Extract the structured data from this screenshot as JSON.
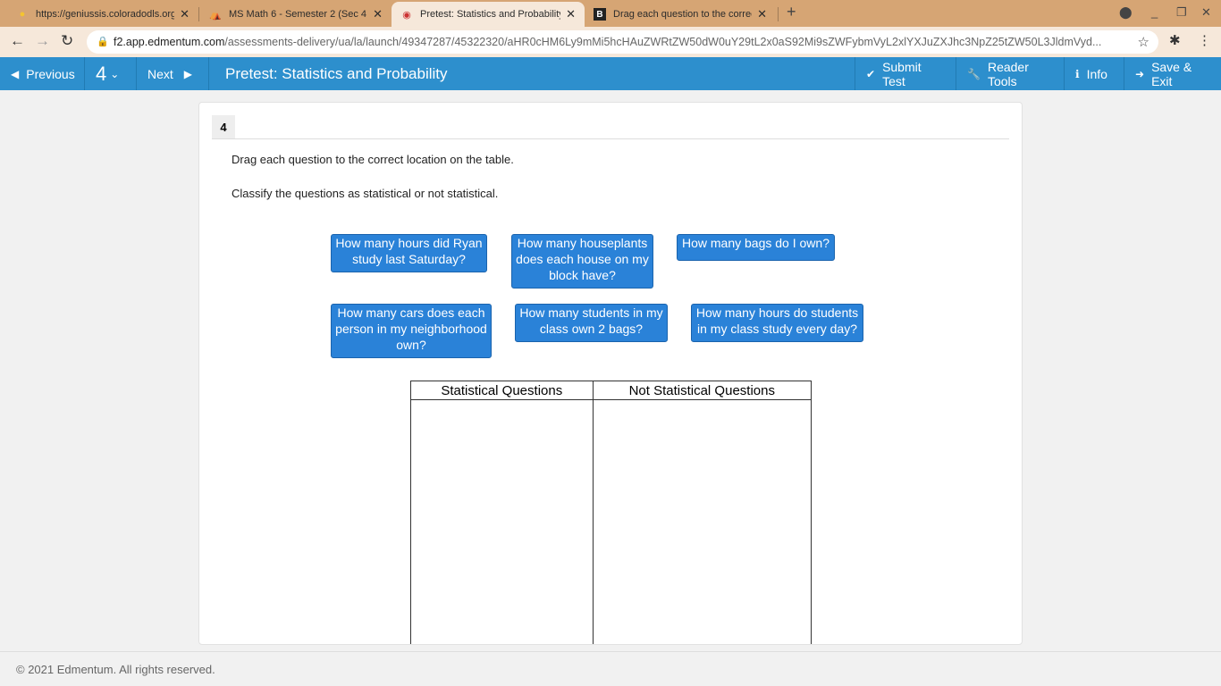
{
  "browser": {
    "tabs": [
      {
        "title": "https://geniussis.coloradodls.org",
        "icon": "lightbulb-icon"
      },
      {
        "title": "MS Math 6 - Semester 2 (Sec 4 C",
        "icon": "course-icon"
      },
      {
        "title": "Pretest: Statistics and Probability",
        "icon": "edmentum-icon"
      },
      {
        "title": "Drag each question to the correct",
        "icon": "brainly-icon"
      }
    ],
    "url_host": "f2.app.edmentum.com",
    "url_path": "/assessments-delivery/ua/la/launch/49347287/45322320/aHR0cHM6Ly9mMi5hcHAuZWRtZW50dW0uY29tL2x0aS92Mi9sZWFybmVyL2xlYXJuZXJhc3NpZ25tZW50L3JldmVyd..."
  },
  "toolbar": {
    "previous": "Previous",
    "question_number": "4",
    "next": "Next",
    "title": "Pretest: Statistics and Probability",
    "submit": "Submit Test",
    "reader_tools": "Reader Tools",
    "info": "Info",
    "save_exit": "Save & Exit"
  },
  "question": {
    "number": "4",
    "instruction1": "Drag each question to the correct location on the table.",
    "instruction2": "Classify the questions as statistical or not statistical.",
    "chips": [
      "How many hours did Ryan study last Saturday?",
      "How many houseplants does each house on my block have?",
      "How many bags do I own?",
      "How many cars does each person in my neighborhood own?",
      "How many students in my class own 2 bags?",
      "How many hours do students in my class study every day?"
    ],
    "table_headers": [
      "Statistical Questions",
      "Not Statistical Questions"
    ]
  },
  "footer": "© 2021 Edmentum. All rights reserved."
}
